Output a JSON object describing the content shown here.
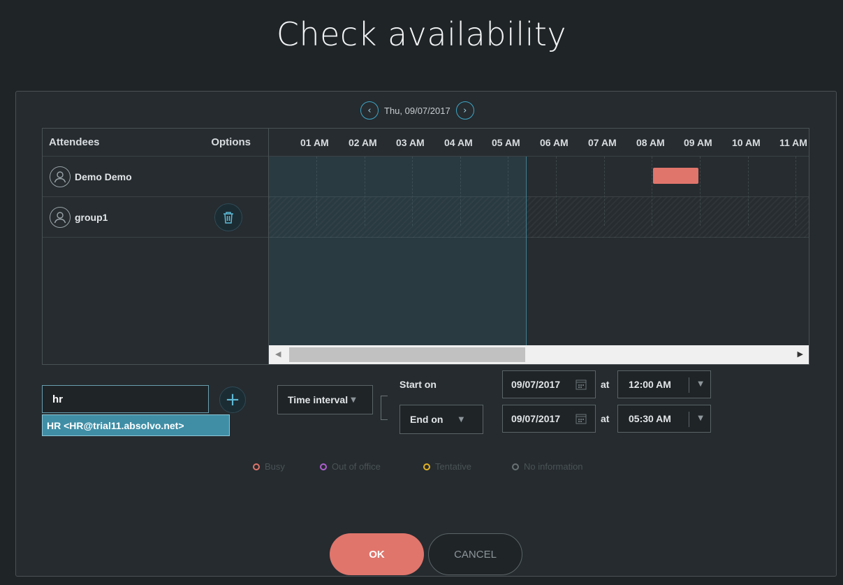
{
  "dialog": {
    "title": "Check availability"
  },
  "date_nav": {
    "date_label": "Thu, 09/07/2017",
    "prev_icon": "chevron-left-icon",
    "next_icon": "chevron-right-icon"
  },
  "attendees": {
    "header_label": "Attendees",
    "options_label": "Options",
    "rows": [
      {
        "name": "Demo Demo",
        "icon": "user-icon"
      },
      {
        "name": "group1",
        "icon": "user-icon",
        "action_icon": "trash-icon"
      }
    ]
  },
  "timeline": {
    "hours": [
      "01 AM",
      "02 AM",
      "03 AM",
      "04 AM",
      "05 AM",
      "06 AM",
      "07 AM",
      "08 AM",
      "09 AM",
      "10 AM",
      "11 AM"
    ],
    "busy_color": "#e0756c",
    "selection_color": "#3e7f92"
  },
  "add_attendee": {
    "input_value": "hr",
    "add_icon": "plus-icon",
    "suggestion": "HR <HR@trial11.absolvo.net>"
  },
  "time_controls": {
    "mode_label": "Time interval",
    "start_label": "Start on",
    "end_label": "End on",
    "start_date": "09/07/2017",
    "end_date": "09/07/2017",
    "at_label": "at",
    "start_time": "12:00 AM",
    "end_time": "05:30 AM",
    "calendar_icon": "calendar-icon",
    "caret_icon": "caret-down-icon"
  },
  "legend": [
    {
      "label": "Busy",
      "color": "#e0756c"
    },
    {
      "label": "Out of office",
      "color": "#b05fd0"
    },
    {
      "label": "Tentative",
      "color": "#e4b423"
    },
    {
      "label": "No information",
      "color": "#6a7276"
    }
  ],
  "footer": {
    "ok_label": "OK",
    "cancel_label": "CANCEL"
  },
  "colors": {
    "accent": "#3fa6c6",
    "primary_button": "#e0756c",
    "background": "#1f2427"
  }
}
